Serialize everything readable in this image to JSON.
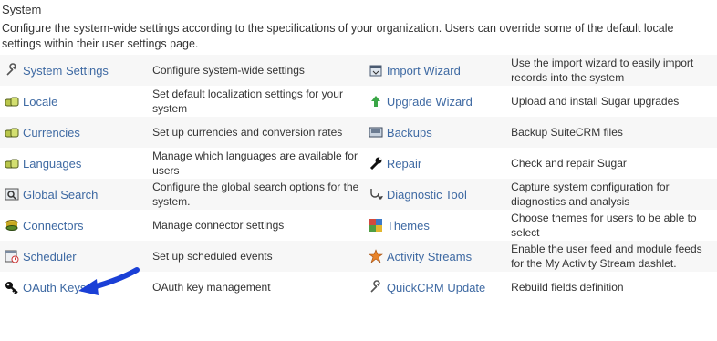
{
  "header": {
    "title": "System",
    "description": "Configure the system-wide settings according to the specifications of your organization. Users can override some of the default locale settings within their user settings page."
  },
  "rows": [
    {
      "left": {
        "label": "System Settings",
        "icon": "wrench-icon",
        "desc": "Configure system-wide settings"
      },
      "right": {
        "label": "Import Wizard",
        "icon": "import-icon",
        "desc": "Use the import wizard to easily import records into the system"
      }
    },
    {
      "left": {
        "label": "Locale",
        "icon": "locale-icon",
        "desc": "Set default localization settings for your system"
      },
      "right": {
        "label": "Upgrade Wizard",
        "icon": "upgrade-arrow-icon",
        "desc": "Upload and install Sugar upgrades"
      }
    },
    {
      "left": {
        "label": "Currencies",
        "icon": "currency-icon",
        "desc": "Set up currencies and conversion rates"
      },
      "right": {
        "label": "Backups",
        "icon": "backup-icon",
        "desc": "Backup SuiteCRM files"
      }
    },
    {
      "left": {
        "label": "Languages",
        "icon": "language-icon",
        "desc": "Manage which languages are available for users"
      },
      "right": {
        "label": "Repair",
        "icon": "repair-wrench-icon",
        "desc": "Check and repair Sugar"
      }
    },
    {
      "left": {
        "label": "Global Search",
        "icon": "search-icon",
        "desc": "Configure the global search options for the system."
      },
      "right": {
        "label": "Diagnostic Tool",
        "icon": "stethoscope-icon",
        "desc": "Capture system configuration for diagnostics and analysis"
      }
    },
    {
      "left": {
        "label": "Connectors",
        "icon": "connector-icon",
        "desc": "Manage connector settings"
      },
      "right": {
        "label": "Themes",
        "icon": "themes-icon",
        "desc": "Choose themes for users to be able to select"
      }
    },
    {
      "left": {
        "label": "Scheduler",
        "icon": "scheduler-icon",
        "desc": "Set up scheduled events"
      },
      "right": {
        "label": "Activity Streams",
        "icon": "activity-stream-icon",
        "desc": "Enable the user feed and module feeds for the My Activity Stream dashlet."
      }
    },
    {
      "left": {
        "label": "OAuth Keys",
        "icon": "key-icon",
        "desc": "OAuth key management"
      },
      "right": {
        "label": "QuickCRM Update",
        "icon": "wrench-icon",
        "desc": "Rebuild fields definition"
      }
    }
  ],
  "colors": {
    "link": "#3f6aa3",
    "annotation_arrow": "#1a3fd6"
  }
}
